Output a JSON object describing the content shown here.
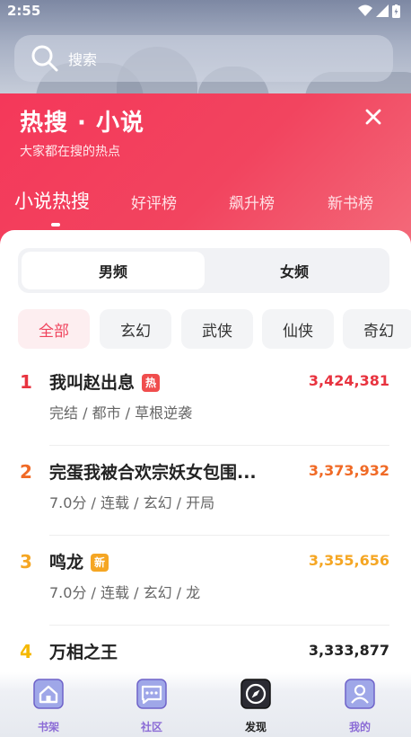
{
  "status": {
    "time": "2:55"
  },
  "search": {
    "placeholder": "搜索"
  },
  "hot": {
    "title": "热搜 · 小说",
    "subtitle": "大家都在搜的热点",
    "tabs": [
      "小说热搜",
      "好评榜",
      "飙升榜",
      "新书榜"
    ],
    "active_tab": 0
  },
  "gender": {
    "options": [
      "男频",
      "女频"
    ],
    "selected": 0
  },
  "filters": {
    "items": [
      "全部",
      "玄幻",
      "武侠",
      "仙侠",
      "奇幻"
    ],
    "selected": 0
  },
  "list": [
    {
      "rank": "1",
      "name": "我叫赵出息",
      "badge": "热",
      "tags": "完结 / 都市 / 草根逆袭",
      "score": "3,424,381"
    },
    {
      "rank": "2",
      "name": "完蛋我被合欢宗妖女包围...",
      "badge": "",
      "tags": "7.0分 / 连载 / 玄幻 / 开局",
      "score": "3,373,932"
    },
    {
      "rank": "3",
      "name": "鸣龙",
      "badge": "新",
      "tags": "7.0分 / 连载 / 玄幻 / 龙",
      "score": "3,355,656"
    },
    {
      "rank": "4",
      "name": "万相之王",
      "badge": "",
      "tags": "",
      "score": "3,333,877"
    }
  ],
  "nav": {
    "items": [
      {
        "label": "书架",
        "icon": "house-icon"
      },
      {
        "label": "社区",
        "icon": "chat-icon"
      },
      {
        "label": "发现",
        "icon": "compass-icon"
      },
      {
        "label": "我的",
        "icon": "profile-icon"
      }
    ],
    "active": 2
  },
  "colors": {
    "accent": "#f0445d",
    "rank1": "#e8333f",
    "rank2": "#f06a26",
    "rank3": "#f5a623",
    "rank4": "#f5b800",
    "badge_hot": "#f04d4d",
    "badge_new": "#f5a623"
  }
}
